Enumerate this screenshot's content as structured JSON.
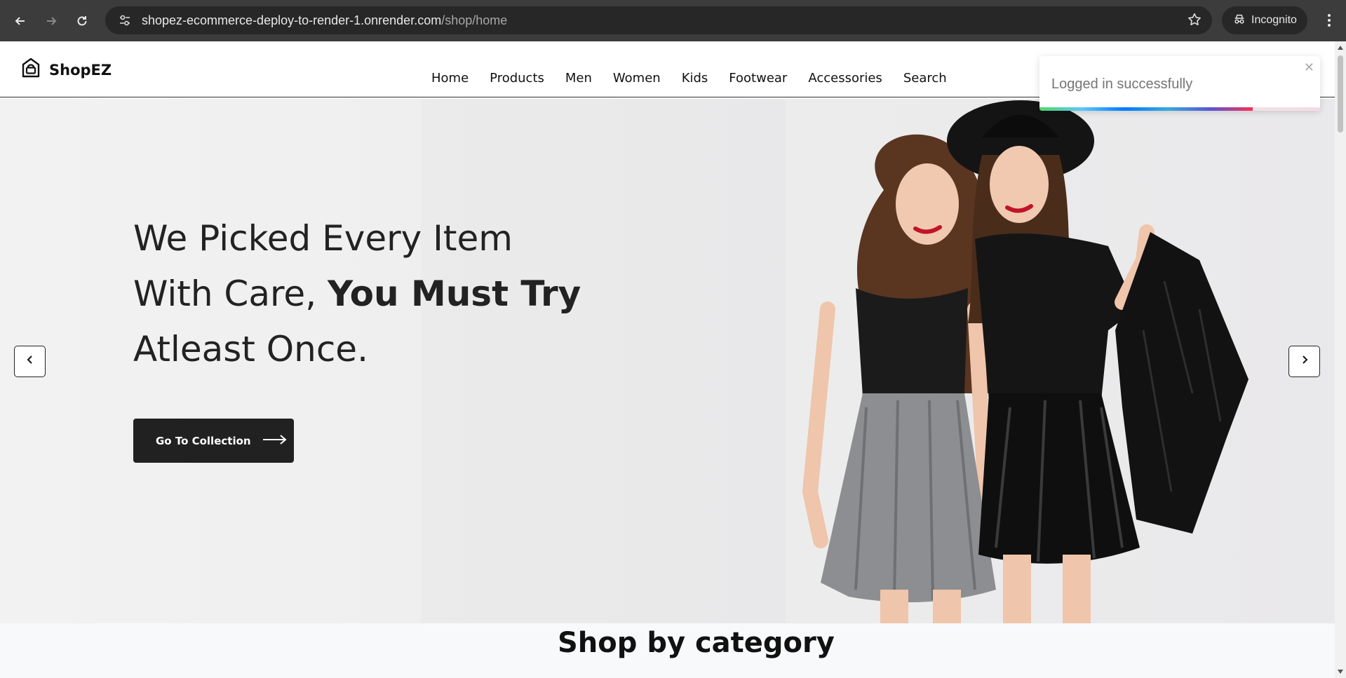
{
  "browser": {
    "url_host": "shopez-ecommerce-deploy-to-render-1.onrender.com",
    "url_path": "/shop/home",
    "profile_label": "Incognito"
  },
  "site": {
    "brand": "ShopEZ",
    "menu": [
      "Home",
      "Products",
      "Men",
      "Women",
      "Kids",
      "Footwear",
      "Accessories",
      "Search"
    ]
  },
  "hero": {
    "line1": "We Picked Every Item",
    "line2_plain": "With Care, ",
    "line2_bold": "You Must Try",
    "line3": "Atleast Once.",
    "cta_label": "Go To Collection"
  },
  "section": {
    "title": "Shop by category"
  },
  "toast": {
    "message": "Logged in successfully",
    "progress": 0.76
  },
  "colors": {
    "chrome_bg": "#3c3c3c",
    "omnibox_bg": "#272727",
    "cta_bg": "#212121",
    "hero_bg": "#ededee"
  }
}
